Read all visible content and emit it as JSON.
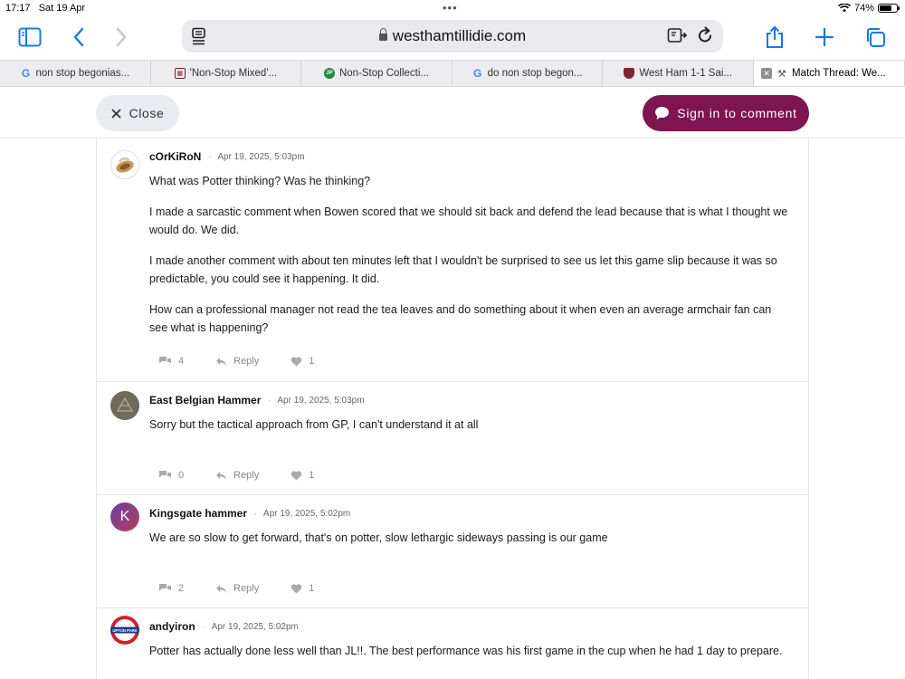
{
  "status_bar": {
    "time": "17:17",
    "date": "Sat 19 Apr",
    "battery": "74%",
    "battery_level": 0.74
  },
  "toolbar": {
    "url": "westhamtillidie.com"
  },
  "tabs": [
    {
      "title": "non stop begonias...",
      "icon": "google-icon"
    },
    {
      "title": "'Non-Stop Mixed'...",
      "icon": "shop-icon"
    },
    {
      "title": "Non-Stop Collecti...",
      "icon": "garden-icon"
    },
    {
      "title": "do non stop begon...",
      "icon": "google-icon"
    },
    {
      "title": "West Ham 1-1 Sai...",
      "icon": "west-ham-crest-icon"
    },
    {
      "title": "Match Thread: We...",
      "icon": "hammers-icon",
      "active": true
    }
  ],
  "header": {
    "close_label": "Close",
    "signin_label": "Sign in to comment"
  },
  "comments": [
    {
      "author": "cOrKiRoN",
      "timestamp": "Apr 19, 2025, 5:03pm",
      "paragraphs": [
        "What was Potter thinking? Was he thinking?",
        "I made a sarcastic comment when Bowen scored that we should sit back and defend the lead because that is what I thought we would do. We did.",
        "I made another comment with about ten minutes left that I wouldn't be surprised to see us let this game slip because it was so predictable, you could see it happening. It did.",
        "How can a professional manager not read the tea leaves and do something about it when even an average armchair fan can see what is happening?"
      ],
      "replies": "4",
      "reply_label": "Reply",
      "likes": "1"
    },
    {
      "author": "East Belgian Hammer",
      "timestamp": "Apr 19, 2025, 5:03pm",
      "paragraphs": [
        "Sorry but the tactical approach from GP, I can't understand it at all"
      ],
      "replies": "0",
      "reply_label": "Reply",
      "likes": "1"
    },
    {
      "author": "Kingsgate hammer",
      "avatar_letter": "K",
      "timestamp": "Apr 19, 2025, 5:02pm",
      "paragraphs": [
        "We are so slow to get forward, that's on potter, slow lethargic sideways passing is our game"
      ],
      "replies": "2",
      "reply_label": "Reply",
      "likes": "1"
    },
    {
      "author": "andyiron",
      "avatar_text": "UPTON PARK",
      "timestamp": "Apr 19, 2025, 5:02pm",
      "paragraphs": [
        "Potter has actually done less well than JL!!. The best performance was his first game in the cup when he had 1 day to prepare."
      ]
    }
  ],
  "colors": {
    "accent": "#1677e8",
    "brand": "#7e1450"
  }
}
